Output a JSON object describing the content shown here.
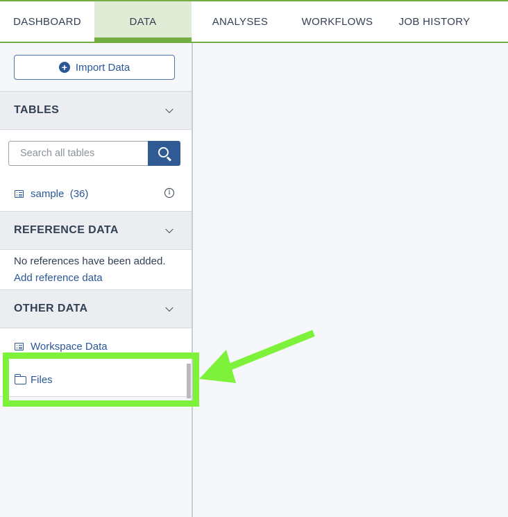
{
  "nav": {
    "tabs": [
      {
        "label": "DASHBOARD",
        "active": false
      },
      {
        "label": "DATA",
        "active": true
      },
      {
        "label": "ANALYSES",
        "active": false
      },
      {
        "label": "WORKFLOWS",
        "active": false
      },
      {
        "label": "JOB HISTORY",
        "active": false
      }
    ],
    "accent_color": "#74ae43"
  },
  "sidebar": {
    "import_button": {
      "label": "Import Data",
      "icon": "plus-circle-icon"
    },
    "tables": {
      "title": "TABLES",
      "search_placeholder": "Search all tables",
      "items": [
        {
          "name": "sample",
          "count": "(36)",
          "icon": "table-list-icon"
        }
      ]
    },
    "reference_data": {
      "title": "REFERENCE DATA",
      "empty_text": "No references have been added.",
      "add_link": "Add reference data"
    },
    "other_data": {
      "title": "OTHER DATA",
      "items": [
        {
          "label": "Workspace Data",
          "icon": "table-list-icon"
        },
        {
          "label": "Files",
          "icon": "folder-icon"
        }
      ]
    }
  },
  "annotation": {
    "color": "#7ef23a",
    "target": "Files"
  }
}
